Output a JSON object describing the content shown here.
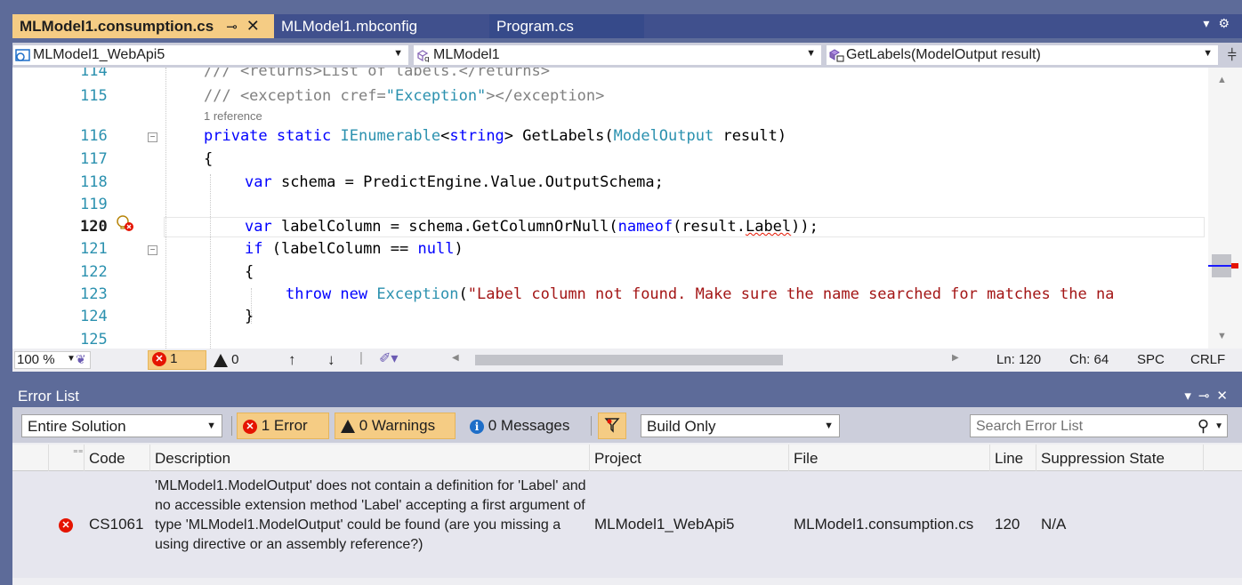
{
  "tabs": [
    {
      "label": "MLModel1.consumption.cs",
      "active": true
    },
    {
      "label": "MLModel1.mbconfig",
      "active": false
    },
    {
      "label": "Program.cs",
      "active": false
    }
  ],
  "tab_pin_icon": "pin-icon",
  "tab_close_icon": "close-icon",
  "navbar": {
    "project": "MLModel1_WebApi5",
    "class": "MLModel1",
    "member": "GetLabels(ModelOutput result)"
  },
  "editor": {
    "line_numbers": [
      "114",
      "115",
      "116",
      "117",
      "118",
      "119",
      "120",
      "121",
      "122",
      "123",
      "124",
      "125"
    ],
    "codelens": "1 reference",
    "line114": "/// <returns>List of labels.</returns>",
    "line115_a": "/// <exception cref=",
    "line115_b": "\"Exception\"",
    "line115_c": "></exception>",
    "line116_kw": "private static ",
    "line116_ty": "IEnumerable",
    "line116_a": "<",
    "line116_kw2": "string",
    "line116_b": "> GetLabels(",
    "line116_ty2": "ModelOutput",
    "line116_c": " result)",
    "line117": "{",
    "line118_kw": "var",
    "line118_rest": " schema = PredictEngine.Value.OutputSchema;",
    "line120_kw": "var",
    "line120_a": " labelColumn = schema.GetColumnOrNull(",
    "line120_kw2": "nameof",
    "line120_b": "(result.",
    "line120_err": "Label",
    "line120_c": "));",
    "line121_kw": "if",
    "line121_a": " (labelColumn == ",
    "line121_kw2": "null",
    "line121_b": ")",
    "line122": "{",
    "line123_kw": "throw new ",
    "line123_ty": "Exception",
    "line123_a": "(",
    "line123_st": "\"Label column not found. Make sure the name searched for matches the na",
    "line124": "}"
  },
  "status": {
    "zoom": "100 %",
    "errors": "1",
    "warnings": "0",
    "ln": "Ln: 120",
    "ch": "Ch: 64",
    "spc": "SPC",
    "crlf": "CRLF"
  },
  "error_list": {
    "title": "Error List",
    "scope": "Entire Solution",
    "errors_btn": "1 Error",
    "warnings_btn": "0 Warnings",
    "messages_btn": "0 Messages",
    "build_filter": "Build Only",
    "search_placeholder": "Search Error List",
    "columns": [
      "Code",
      "Description",
      "Project",
      "File",
      "Line",
      "Suppression State"
    ],
    "rows": [
      {
        "code": "CS1061",
        "description": "'MLModel1.ModelOutput' does not contain a definition for 'Label' and no accessible extension method 'Label' accepting a first argument of type 'MLModel1.ModelOutput' could be found (are you missing a using directive or an assembly reference?)",
        "project": "MLModel1_WebApi5",
        "file": "MLModel1.consumption.cs",
        "line": "120",
        "suppression": "N/A"
      }
    ]
  },
  "colors": {
    "accent_tab": "#f5cc84",
    "chrome": "#5d6b99",
    "error": "#e51400",
    "keyword": "#0000ff",
    "type": "#2b91af",
    "string": "#a31515",
    "comment": "#008000"
  }
}
